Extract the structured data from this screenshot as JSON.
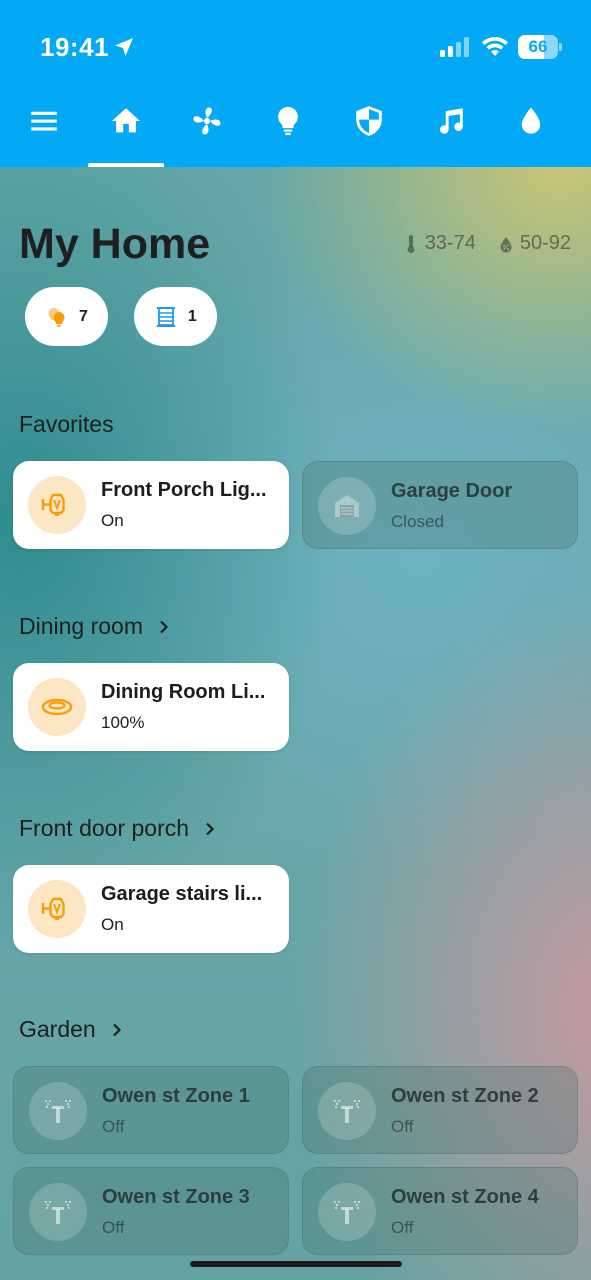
{
  "status_bar": {
    "time": "19:41",
    "battery": "66",
    "battery_level": 0.66
  },
  "tabs": [
    {
      "icon": "menu-icon",
      "active": false
    },
    {
      "icon": "home-icon",
      "active": true
    },
    {
      "icon": "fan-icon",
      "active": false
    },
    {
      "icon": "lightbulb-icon",
      "active": false
    },
    {
      "icon": "shield-icon",
      "active": false
    },
    {
      "icon": "music-icon",
      "active": false
    },
    {
      "icon": "water-drop-icon",
      "active": false
    }
  ],
  "header": {
    "title": "My Home",
    "temperature_range": "33-74",
    "humidity_range": "50-92"
  },
  "chips": [
    {
      "icon": "lights-on-icon",
      "count": "7",
      "color": "#f59e0b"
    },
    {
      "icon": "window-blind-icon",
      "count": "1",
      "color": "#2196f3"
    }
  ],
  "sections": {
    "favorites": {
      "title": "Favorites",
      "cards": [
        {
          "name": "Front Porch Lig...",
          "state": "On",
          "icon": "porch-light-icon",
          "on": true
        },
        {
          "name": "Garage Door",
          "state": "Closed",
          "icon": "garage-door-icon",
          "on": false
        }
      ]
    },
    "dining_room": {
      "title": "Dining room",
      "cards": [
        {
          "name": "Dining Room Li...",
          "state": "100%",
          "icon": "ceiling-light-icon",
          "on": true
        }
      ]
    },
    "front_door_porch": {
      "title": "Front door porch",
      "cards": [
        {
          "name": "Garage stairs li...",
          "state": "On",
          "icon": "porch-light-icon",
          "on": true
        }
      ]
    },
    "garden": {
      "title": "Garden",
      "cards": [
        {
          "name": "Owen st Zone 1",
          "state": "Off",
          "icon": "sprinkler-icon",
          "on": false
        },
        {
          "name": "Owen st Zone 2",
          "state": "Off",
          "icon": "sprinkler-icon",
          "on": false
        },
        {
          "name": "Owen st Zone 3",
          "state": "Off",
          "icon": "sprinkler-icon",
          "on": false
        },
        {
          "name": "Owen st Zone 4",
          "state": "Off",
          "icon": "sprinkler-icon",
          "on": false
        }
      ]
    }
  },
  "colors": {
    "topbar": "#03a9f4",
    "light_on_accent": "#f59e0b",
    "light_on_circle": "#fde6c4"
  }
}
